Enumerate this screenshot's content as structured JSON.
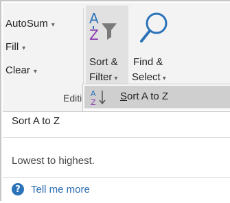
{
  "editing": {
    "autosum_label": "AutoSum",
    "fill_label": "Fill",
    "clear_label": "Clear",
    "group_label": "Editi",
    "sort_filter_line1": "Sort &",
    "sort_filter_line2": "Filter",
    "find_select_line1": "Find &",
    "find_select_line2": "Select",
    "dropdown_arrow": "▾",
    "collapse_caret": "^"
  },
  "menu": {
    "item_label": "Sort A to Z",
    "item_icon": "sort-a-to-z-icon"
  },
  "tooltip": {
    "title": "Sort A to Z",
    "description": "Lowest to highest.",
    "link_label": "Tell me more",
    "link_icon": "help-circle-icon",
    "link_icon_glyph": "?"
  },
  "colors": {
    "ribbon_bg": "#f3f3f3",
    "pressed_button_bg": "#e1e1e1",
    "menu_highlight": "#cfcfcf",
    "icon_blue": "#2b73b9",
    "icon_purple": "#8c3bb0"
  }
}
